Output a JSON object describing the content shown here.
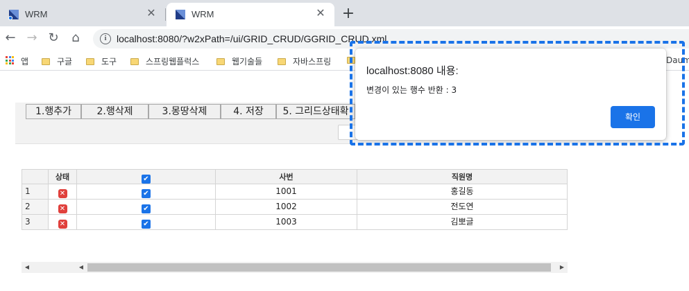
{
  "browser": {
    "tabs": [
      {
        "title": "WRM",
        "active": false
      },
      {
        "title": "WRM",
        "active": true
      }
    ],
    "close_glyph": "✕",
    "new_tab_glyph": "+",
    "url": "localhost:8080/?w2xPath=/ui/GRID_CRUD/GGRID_CRUD.xml",
    "nav": {
      "back": "←",
      "forward": "→",
      "reload": "↻",
      "home": "⌂"
    }
  },
  "bookmarks": {
    "apps_label": "앱",
    "items": [
      "구글",
      "도구",
      "스프링웹플럭스",
      "웹기술들",
      "자바스프링"
    ],
    "overflow_item": "Daum"
  },
  "toolbar": {
    "buttons": [
      "1.행추가",
      "2.행삭제",
      "3.몽땅삭제",
      "4. 저장",
      "5. 그리드상태확"
    ]
  },
  "grid": {
    "headers": [
      "상태",
      "✔",
      "사번",
      "직원명"
    ],
    "rows": [
      {
        "num": "1",
        "status": "✕",
        "checked": "✔",
        "id": "1001",
        "name": "홍길동"
      },
      {
        "num": "2",
        "status": "✕",
        "checked": "✔",
        "id": "1002",
        "name": "전도연"
      },
      {
        "num": "3",
        "status": "✕",
        "checked": "✔",
        "id": "1003",
        "name": "김뽀글"
      }
    ]
  },
  "scrollbar": {
    "left_arrow": "◀",
    "right_arrow": "▶"
  },
  "dialog": {
    "title": "localhost:8080 내용:",
    "message": "변경이 있는 행수 반환 : 3",
    "ok_label": "확인"
  },
  "colors": {
    "accent": "#1a73e8",
    "status_error": "#e0403c",
    "tab_strip": "#dee1e6"
  }
}
